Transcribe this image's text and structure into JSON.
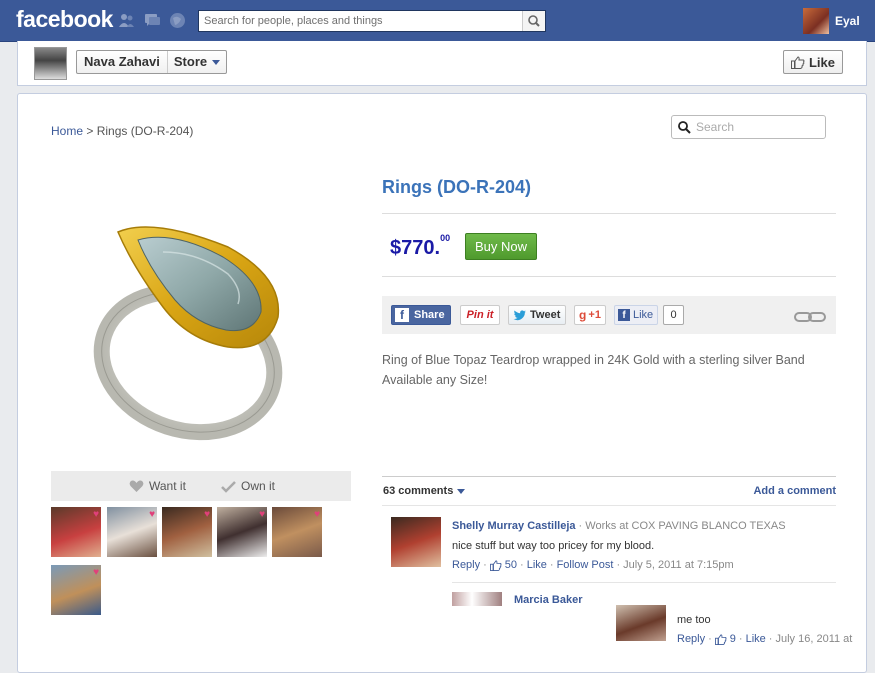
{
  "topbar": {
    "logo": "facebook",
    "search_placeholder": "Search for people, places and things",
    "user_name": "Eyal",
    "icons": [
      "friends-icon",
      "messages-icon",
      "notifications-icon",
      "search-icon"
    ]
  },
  "page_header": {
    "page_name": "Nava Zahavi",
    "section": "Store",
    "like_label": "Like"
  },
  "store": {
    "breadcrumb_home": "Home",
    "breadcrumb_sep": " > ",
    "breadcrumb_current": "Rings (DO-R-204)",
    "search_placeholder": "Search"
  },
  "product": {
    "title": "Rings (DO-R-204)",
    "price_main": "$770.",
    "price_cents": "00",
    "buy_label": "Buy Now",
    "description_line1": "Ring of Blue Topaz Teardrop wrapped in 24K Gold with a sterling silver Band",
    "description_line2": "Available any Size!",
    "want_label": "Want it",
    "own_label": "Own it"
  },
  "share": {
    "facebook_share": "Share",
    "pinit": "Pin it",
    "tweet": "Tweet",
    "gplus": "+1",
    "like": "Like",
    "like_count": "0"
  },
  "comments": {
    "count_label": "63 comments",
    "add_label": "Add a comment",
    "items": [
      {
        "name": "Shelly Murray Castilleja",
        "work": " · Works at COX PAVING BLANCO TEXAS",
        "text": "nice stuff but way too pricey for my blood.",
        "reply": "Reply",
        "likes": "50",
        "like": "Like",
        "follow": "Follow Post",
        "date": " · July 5, 2011 at 7:15pm"
      },
      {
        "name": "Marcia Baker"
      },
      {
        "text": "me too",
        "reply": "Reply",
        "likes": "9",
        "like": "Like",
        "date": " · July 16, 2011 at"
      }
    ]
  },
  "colors": {
    "facebook_blue": "#3b5998",
    "title_blue": "#3b73b9",
    "price_blue": "#1a1aa6",
    "buy_green": "#5aa83a"
  }
}
